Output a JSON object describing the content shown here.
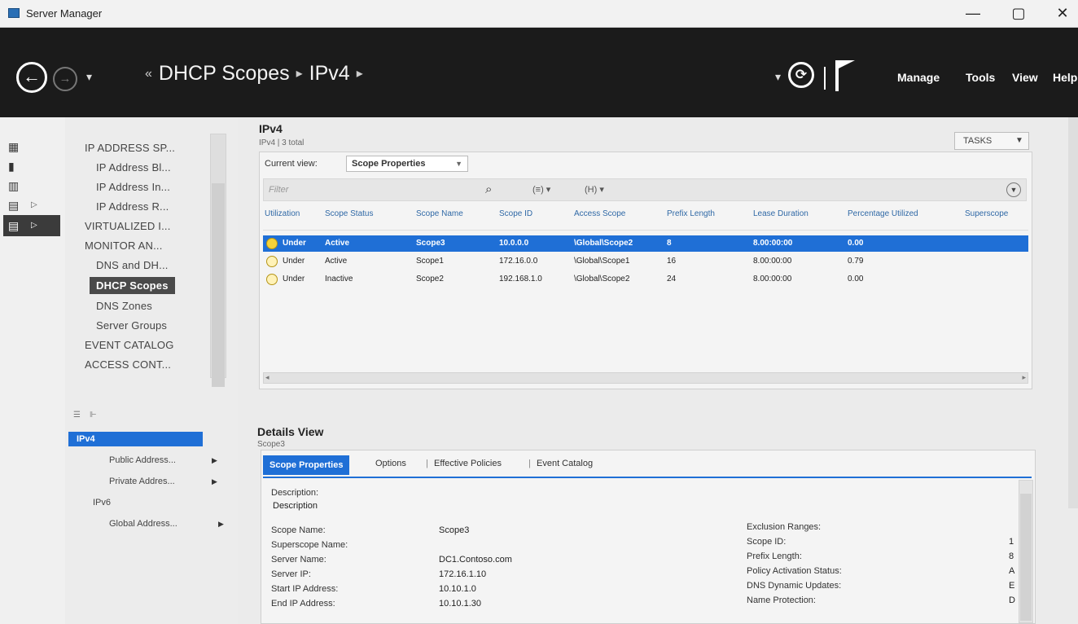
{
  "window": {
    "title": "Server Manager",
    "min": "—",
    "max": "▢",
    "close": "✕"
  },
  "nav": {
    "crumbs": [
      "DHCP Scopes",
      "IPv4"
    ],
    "crumb_prefix": "«",
    "crumb_sep": "▸",
    "menus": [
      "Manage",
      "Tools",
      "View",
      "Help"
    ]
  },
  "tree": {
    "items": [
      "IP ADDRESS SP...",
      "IP Address Bl...",
      "IP Address In...",
      "IP Address R...",
      "VIRTUALIZED I...",
      "MONITOR AN...",
      "DNS and DH...",
      "DHCP Scopes",
      "DNS Zones",
      "Server Groups",
      "EVENT CATALOG",
      "ACCESS CONT..."
    ],
    "sub": {
      "ipv4": "IPv4",
      "public": "Public Address...",
      "private": "Private Addres...",
      "ipv6": "IPv6",
      "global": "Global Address..."
    }
  },
  "tile": {
    "title": "IPv4",
    "subtitle": "IPv4 | 3 total",
    "tasks": "TASKS",
    "current_view_label": "Current view:",
    "current_view": "Scope Properties",
    "filter_placeholder": "Filter",
    "opt1": "(≡) ▾",
    "opt2": "(H) ▾"
  },
  "grid": {
    "columns": [
      "Utilization",
      "Scope Status",
      "Scope Name",
      "Scope ID",
      "Access Scope",
      "Prefix Length",
      "Lease Duration",
      "Percentage Utilized",
      "Superscope"
    ],
    "rows": [
      {
        "util": "Under",
        "status": "Active",
        "name": "Scope3",
        "id": "10.0.0.0",
        "access": "\\Global\\Scope2",
        "prefix": "8",
        "lease": "8.00:00:00",
        "pct": "0.00",
        "selected": true
      },
      {
        "util": "Under",
        "status": "Active",
        "name": "Scope1",
        "id": "172.16.0.0",
        "access": "\\Global\\Scope1",
        "prefix": "16",
        "lease": "8.00:00:00",
        "pct": "0.79",
        "selected": false
      },
      {
        "util": "Under",
        "status": "Inactive",
        "name": "Scope2",
        "id": "192.168.1.0",
        "access": "\\Global\\Scope2",
        "prefix": "24",
        "lease": "8.00:00:00",
        "pct": "0.00",
        "selected": false
      }
    ]
  },
  "details": {
    "title": "Details View",
    "subtitle": "Scope3",
    "tabs": [
      "Scope Properties",
      "Options",
      "Effective Policies",
      "Event Catalog"
    ],
    "description_label": "Description:",
    "description_value": "Description",
    "left_pairs": [
      {
        "k": "Scope Name:",
        "v": "Scope3"
      },
      {
        "k": "Superscope Name:",
        "v": ""
      },
      {
        "k": "Server Name:",
        "v": "DC1.Contoso.com"
      },
      {
        "k": "Server IP:",
        "v": "172.16.1.10"
      },
      {
        "k": "Start IP Address:",
        "v": "10.10.1.0"
      },
      {
        "k": "End IP Address:",
        "v": "10.10.1.30"
      }
    ],
    "right_pairs": [
      {
        "k": "Exclusion Ranges:",
        "v": ""
      },
      {
        "k": "Scope ID:",
        "v": "1"
      },
      {
        "k": "Prefix Length:",
        "v": "8"
      },
      {
        "k": "Policy Activation Status:",
        "v": "A"
      },
      {
        "k": "DNS Dynamic Updates:",
        "v": "E"
      },
      {
        "k": "Name Protection:",
        "v": "D"
      }
    ]
  }
}
